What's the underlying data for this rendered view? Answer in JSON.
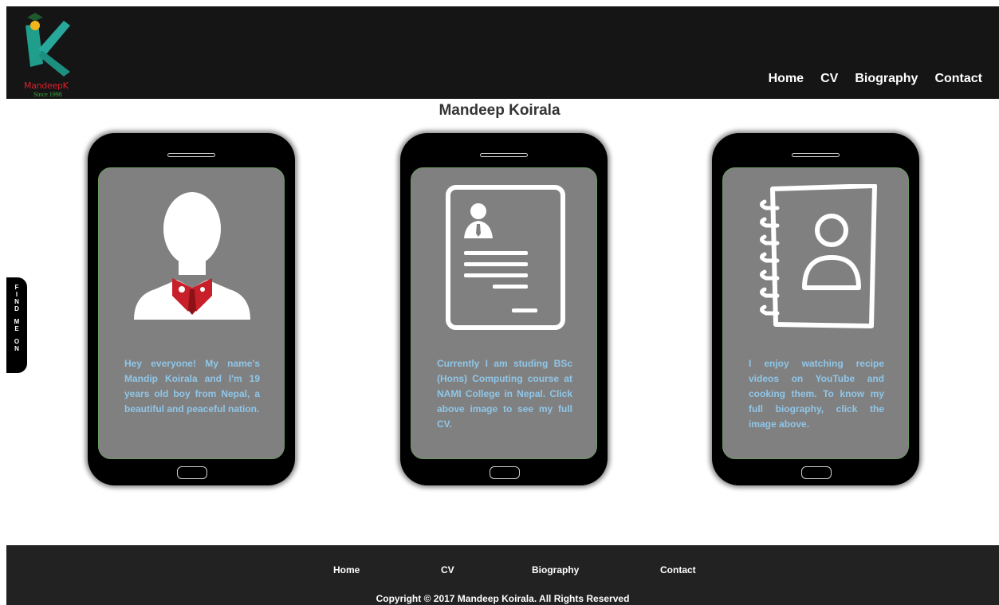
{
  "logo": {
    "name": "MandeepK",
    "since": "Since 1998"
  },
  "nav": {
    "home": "Home",
    "cv": "CV",
    "biography": "Biography",
    "contact": "Contact"
  },
  "page_title": "Mandeep Koirala",
  "cards": [
    {
      "text": "Hey everyone! My name's Mandip Koirala and I'm 19 years old boy from Nepal, a beautiful and peaceful nation.",
      "icon": "person-suit-icon"
    },
    {
      "text": "Currently I am studing BSc (Hons) Computing course at NAMI College in Nepal. Click above image to see my full CV.",
      "icon": "resume-document-icon"
    },
    {
      "text": "I enjoy watching recipe videos on YouTube and cooking them. To know my full biography, click the image above.",
      "icon": "contact-book-icon"
    }
  ],
  "side_tab": {
    "label_lines": [
      "F",
      "I",
      "N",
      "D",
      "",
      "M",
      "E",
      "",
      "O",
      "N"
    ]
  },
  "footer": {
    "nav": {
      "home": "Home",
      "cv": "CV",
      "biography": "Biography",
      "contact": "Contact"
    },
    "copyright": "Copyright © 2017 Mandeep Koirala. All Rights Reserved"
  },
  "colors": {
    "header_bg": "#151515",
    "footer_bg": "#222222",
    "card_text": "#8fc6e8",
    "screen_bg": "#808080",
    "screen_border": "#6c9c61",
    "logo_red": "#d8202a",
    "logo_green": "#3ea843",
    "logo_teal": "#1f9e8c"
  }
}
